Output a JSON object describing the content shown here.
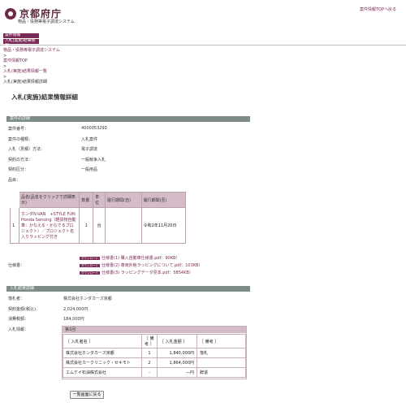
{
  "header": {
    "logo_text": "京都府庁",
    "subsystem": "物品・役務等電子調達システム",
    "top_link": "案件情報TOPへ戻る"
  },
  "tabs": [
    "案件情報",
    "入札(実施)結果情報"
  ],
  "breadcrumb": [
    {
      "label": "物品・役務等電子調達システム",
      "link": true
    },
    {
      "label": ">",
      "link": false
    },
    {
      "label": "案件情報TOP",
      "link": true
    },
    {
      "label": ">",
      "link": false
    },
    {
      "label": "入札(実施)結果情報一覧",
      "link": true
    },
    {
      "label": ">",
      "link": false
    },
    {
      "label": "入札(実施)結果情報詳細",
      "link": false
    }
  ],
  "page_title": "入札(実施)結果情報詳細",
  "case_section": {
    "title": "案件の詳細",
    "fields": [
      {
        "label": "案件番号：",
        "value": "4000053293"
      },
      {
        "label": "案件の種類：",
        "value": "入札案件"
      },
      {
        "label": "入札（見積）方法：",
        "value": "電子調達"
      },
      {
        "label": "契約の方法：",
        "value": "一般競争入札"
      },
      {
        "label": "契約区分：",
        "value": "一般用品"
      }
    ],
    "items_label": "品目：",
    "items_table": {
      "headers": [
        "品名(品名をクリックで詳細表示)",
        "数量",
        "単位",
        "履行期間(自)",
        "履行期間(至)"
      ],
      "rows": [
        {
          "no": "1",
          "name": "ホンダN-VAN　+STYLE FUN Honda Sensing（軽貨物自動車：かなえる・かなでるプロジェクト）／プロジェクト名入りラッピング付き",
          "qty": "1",
          "unit": "台",
          "from": "",
          "to": "令和2年11月20日"
        }
      ]
    },
    "spec_label": "仕様書：",
    "spec_files": [
      {
        "badge": "ダウンロード",
        "text": "仕様書(1) 購入自動車仕様書.pdf：90KB）"
      },
      {
        "badge": "ダウンロード",
        "text": "仕様書(2) 車両外板ラッピングについて.pdf：103KB）"
      },
      {
        "badge": "ダウンロード",
        "text": "仕様書(3) ラッピングデータ見本.pdf：5854KB）"
      }
    ]
  },
  "result_section": {
    "title": "入札結果詳細",
    "fields": [
      {
        "label": "落札者：",
        "value": "株式会社ホンダカーズ京都"
      },
      {
        "label": "契約金額(税込)：",
        "value": "2,024,000円"
      },
      {
        "label": "消費税額：",
        "value": "184,000円"
      }
    ],
    "bid_label": "入札情報：",
    "round_label": "第1回",
    "bid_headers": [
      "［ 入札者名 ］",
      "［ 備考 ］",
      "［ 入札金額 ］",
      "［ 備考 ］"
    ],
    "bids": [
      {
        "name": "株式会社ホンダカーズ京都",
        "no": "1",
        "amount": "1,840,000円",
        "note": "落札"
      },
      {
        "name": "株式会社カークリニック・セキモト",
        "no": "2",
        "amount": "1,864,000円",
        "note": ""
      },
      {
        "name": "エムケイ石油株式会社",
        "no": "-",
        "amount": "―円",
        "note": "辞退"
      }
    ]
  },
  "back_button": "一覧画面に戻る",
  "colors": {
    "accent": "#7a2b55",
    "section_bar": "#7d8c86",
    "table_header": "#d3bcc7"
  }
}
